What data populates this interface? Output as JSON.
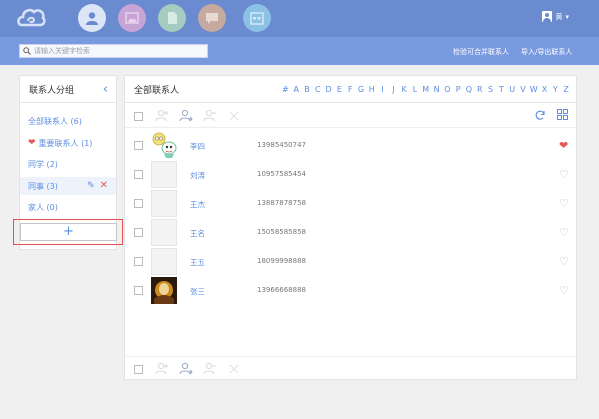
{
  "colors": {
    "topbar": "#6a8bd0",
    "subbar": "#7a9ae0",
    "accent": "#5b8ee0",
    "favorite": "#e25a5a",
    "nav_contacts": "#dde6f7",
    "nav_photos": "#c8a3d6",
    "nav_notes": "#a6cbc0",
    "nav_messages": "#c6a99f",
    "nav_calendar": "#8bc1e4"
  },
  "header": {
    "user_name": "黄",
    "user_menu_arrow": "▾"
  },
  "subbar": {
    "search_placeholder": "请输入关键字检索",
    "check_merge_label": "检验可合并联系人",
    "import_export_label": "导入/导出联系人"
  },
  "groups": {
    "title": "联系人分组",
    "collapse_glyph": "‹",
    "items": [
      {
        "label": "全部联系人 (6)"
      },
      {
        "label": "重要联系人 (1)",
        "heart": "❤"
      },
      {
        "label": "同学 (2)"
      },
      {
        "label": "同事 (3)",
        "edit": "✎",
        "delete": "✕"
      },
      {
        "label": "家人 (0)"
      }
    ],
    "add_label": "+"
  },
  "contacts": {
    "title": "全部联系人",
    "alphabet": [
      "#",
      "A",
      "B",
      "C",
      "D",
      "E",
      "F",
      "G",
      "H",
      "I",
      "J",
      "K",
      "L",
      "M",
      "N",
      "O",
      "P",
      "Q",
      "R",
      "S",
      "T",
      "U",
      "V",
      "W",
      "X",
      "Y",
      "Z"
    ],
    "rows": [
      {
        "name": "李四",
        "phone": "13985450747",
        "favorite": true,
        "avatar": "cartoon"
      },
      {
        "name": "刘涛",
        "phone": "10957585454",
        "favorite": false,
        "avatar": "blank"
      },
      {
        "name": "王杰",
        "phone": "13887878758",
        "favorite": false,
        "avatar": "blank"
      },
      {
        "name": "王名",
        "phone": "15058585858",
        "favorite": false,
        "avatar": "blank"
      },
      {
        "name": "王五",
        "phone": "18099998888",
        "favorite": false,
        "avatar": "blank"
      },
      {
        "name": "张三",
        "phone": "13966668888",
        "favorite": false,
        "avatar": "photo"
      }
    ],
    "heart_filled": "❤",
    "heart_empty": "♡"
  }
}
